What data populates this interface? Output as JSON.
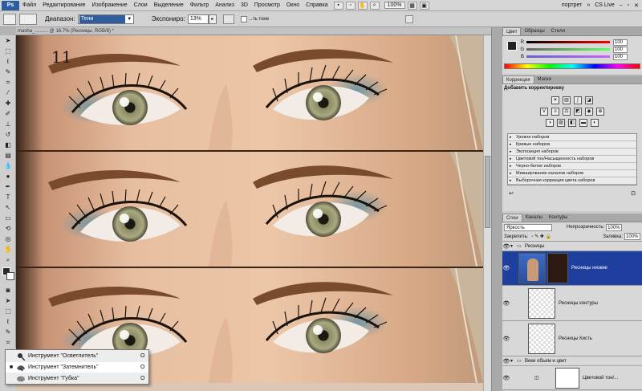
{
  "menubar": {
    "logo": "Ps",
    "items": [
      "Файл",
      "Редактирование",
      "Изображение",
      "Слои",
      "Выделение",
      "Фильтр",
      "Анализ",
      "3D",
      "Просмотр",
      "Окно",
      "Справка"
    ],
    "zoom": "100%",
    "workspace": "портрет",
    "cs_live": "CS Live"
  },
  "options": {
    "range_label": "Диапазон:",
    "range_value": "Тени",
    "exposure_label": "Экспониро:",
    "exposure_value": "13%",
    "protect_label": "...ть тоне"
  },
  "document": {
    "tab": "masha_.......... @ 16.7% (Ресницы, RGB/8) *",
    "step_number": "11"
  },
  "flyout": {
    "items": [
      {
        "label": "Инструмент \"Осветлитель\"",
        "key": "O",
        "active": false
      },
      {
        "label": "Инструмент \"Затемнитель\"",
        "key": "O",
        "active": true
      },
      {
        "label": "Инструмент \"Губка\"",
        "key": "O",
        "active": false
      }
    ]
  },
  "color_panel": {
    "tabs": [
      "Цвет",
      "Образцы",
      "Стили"
    ],
    "sliders": [
      {
        "label": "R",
        "value": "100"
      },
      {
        "label": "G",
        "value": "100"
      },
      {
        "label": "B",
        "value": "100"
      }
    ]
  },
  "adjustments_panel": {
    "tabs": [
      "Коррекция",
      "Маски"
    ],
    "title": "Добавить корректировку",
    "presets": [
      "Уровни наборов",
      "Кривые наборов",
      "Экспозиция наборов",
      "Цветовой тон/Насыщенность наборов",
      "Черно-белое наборов",
      "Микширование каналов наборов",
      "Выборочная коррекция цвета наборов"
    ]
  },
  "layers_panel": {
    "tabs": [
      "Слои",
      "Каналы",
      "Контуры"
    ],
    "blend_mode": "Яркость",
    "opacity_label": "Непрозрачность:",
    "opacity_value": "100%",
    "lock_label": "Закрепить:",
    "fill_label": "Заливка:",
    "fill_value": "100%",
    "group_top": "Ресницы",
    "layers": [
      {
        "name": "Ресницы низкие",
        "selected": true
      },
      {
        "name": "Ресницы контуры",
        "selected": false
      },
      {
        "name": "Ресницы Кисть",
        "selected": false
      }
    ],
    "group_bottom": "Веки объем и цвет",
    "adj_layer": "Цветовой тон/..."
  },
  "colors": {
    "selected_layer": "#1f3f9e",
    "menu_bg": "#d6d6d6",
    "panel_bg": "#d8d8d8"
  }
}
